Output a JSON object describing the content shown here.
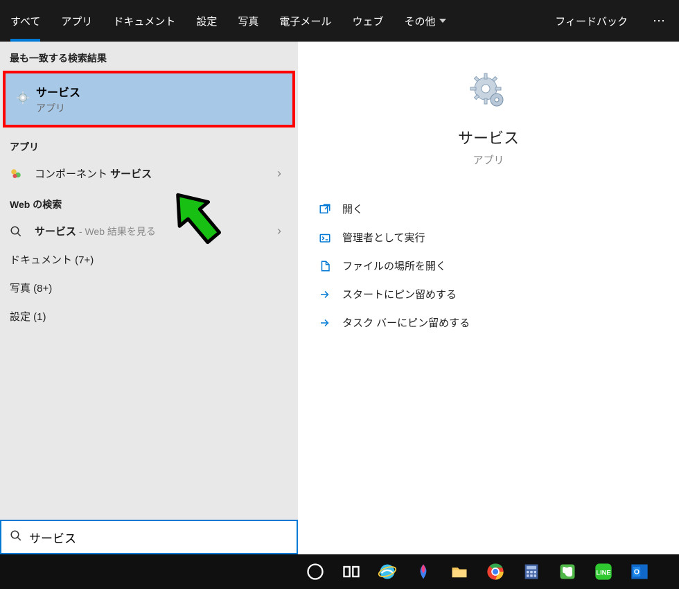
{
  "topbar": {
    "tabs": [
      "すべて",
      "アプリ",
      "ドキュメント",
      "設定",
      "写真",
      "電子メール",
      "ウェブ",
      "その他"
    ],
    "feedback": "フィードバック"
  },
  "left": {
    "best_match_header": "最も一致する検索結果",
    "best_match": {
      "title": "サービス",
      "subtitle": "アプリ"
    },
    "apps_header": "アプリ",
    "component_services_prefix": "コンポーネント ",
    "component_services_bold": "サービス",
    "web_header": "Web の検索",
    "web_search_bold": "サービス",
    "web_search_suffix": " - Web 結果を見る",
    "documents": "ドキュメント (7+)",
    "photos": "写真 (8+)",
    "settings": "設定 (1)"
  },
  "detail": {
    "title": "サービス",
    "subtitle": "アプリ",
    "actions": {
      "open": "開く",
      "run_admin": "管理者として実行",
      "open_location": "ファイルの場所を開く",
      "pin_start": "スタートにピン留めする",
      "pin_taskbar": "タスク バーにピン留めする"
    }
  },
  "search": {
    "value": "サービス"
  },
  "colors": {
    "accent": "#0078d4",
    "highlight_border": "#ff0000",
    "arrow": "#18c013"
  }
}
